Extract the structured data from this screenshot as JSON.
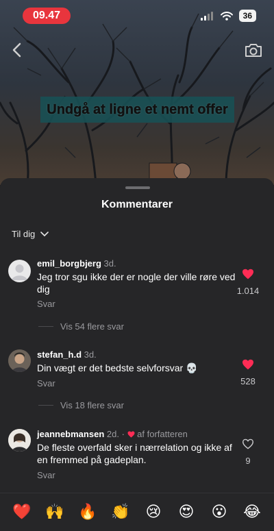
{
  "status_bar": {
    "time": "09.47",
    "battery": "36"
  },
  "video": {
    "caption": "Undgå at ligne et nemt offer"
  },
  "comments_sheet": {
    "title": "Kommentarer",
    "sort_label": "Til dig",
    "comments": [
      {
        "username": "emil_borgbjerg",
        "time": "3d.",
        "text": "Jeg tror sgu ikke der er nogle der ville røre ved dig",
        "reply_label": "Svar",
        "likes": "1.014",
        "liked": true,
        "more_replies": "Vis 54 flere svar"
      },
      {
        "username": "stefan_h.d",
        "time": "3d.",
        "text": "Din vægt er det bedste selvforsvar 💀",
        "reply_label": "Svar",
        "likes": "528",
        "liked": true,
        "more_replies": "Vis 18 flere svar"
      },
      {
        "username": "jeannebmansen",
        "time": "2d. ·",
        "author_badge": "af forfatteren",
        "text": "De fleste overfald sker i nærrelation og ikke af en fremmed på gadeplan.",
        "reply_label": "Svar",
        "likes": "9",
        "liked": false
      }
    ]
  },
  "emoji_bar": [
    "❤️",
    "🙌",
    "🔥",
    "👏",
    "😢",
    "😍",
    "😮",
    "😂"
  ],
  "colors": {
    "like": "#fe2c55",
    "time_pill": "#e8353d",
    "sheet": "#262628"
  }
}
